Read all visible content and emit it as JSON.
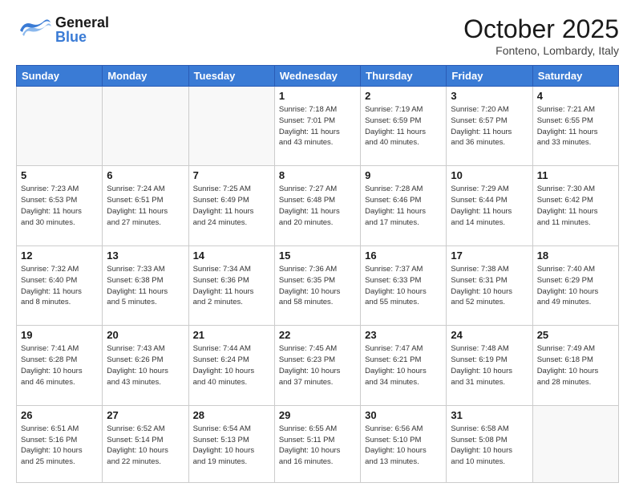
{
  "header": {
    "logo": {
      "general": "General",
      "blue": "Blue"
    },
    "title": "October 2025",
    "location": "Fonteno, Lombardy, Italy"
  },
  "days_of_week": [
    "Sunday",
    "Monday",
    "Tuesday",
    "Wednesday",
    "Thursday",
    "Friday",
    "Saturday"
  ],
  "weeks": [
    {
      "days": [
        {
          "num": "",
          "info": ""
        },
        {
          "num": "",
          "info": ""
        },
        {
          "num": "",
          "info": ""
        },
        {
          "num": "1",
          "info": "Sunrise: 7:18 AM\nSunset: 7:01 PM\nDaylight: 11 hours\nand 43 minutes."
        },
        {
          "num": "2",
          "info": "Sunrise: 7:19 AM\nSunset: 6:59 PM\nDaylight: 11 hours\nand 40 minutes."
        },
        {
          "num": "3",
          "info": "Sunrise: 7:20 AM\nSunset: 6:57 PM\nDaylight: 11 hours\nand 36 minutes."
        },
        {
          "num": "4",
          "info": "Sunrise: 7:21 AM\nSunset: 6:55 PM\nDaylight: 11 hours\nand 33 minutes."
        }
      ]
    },
    {
      "days": [
        {
          "num": "5",
          "info": "Sunrise: 7:23 AM\nSunset: 6:53 PM\nDaylight: 11 hours\nand 30 minutes."
        },
        {
          "num": "6",
          "info": "Sunrise: 7:24 AM\nSunset: 6:51 PM\nDaylight: 11 hours\nand 27 minutes."
        },
        {
          "num": "7",
          "info": "Sunrise: 7:25 AM\nSunset: 6:49 PM\nDaylight: 11 hours\nand 24 minutes."
        },
        {
          "num": "8",
          "info": "Sunrise: 7:27 AM\nSunset: 6:48 PM\nDaylight: 11 hours\nand 20 minutes."
        },
        {
          "num": "9",
          "info": "Sunrise: 7:28 AM\nSunset: 6:46 PM\nDaylight: 11 hours\nand 17 minutes."
        },
        {
          "num": "10",
          "info": "Sunrise: 7:29 AM\nSunset: 6:44 PM\nDaylight: 11 hours\nand 14 minutes."
        },
        {
          "num": "11",
          "info": "Sunrise: 7:30 AM\nSunset: 6:42 PM\nDaylight: 11 hours\nand 11 minutes."
        }
      ]
    },
    {
      "days": [
        {
          "num": "12",
          "info": "Sunrise: 7:32 AM\nSunset: 6:40 PM\nDaylight: 11 hours\nand 8 minutes."
        },
        {
          "num": "13",
          "info": "Sunrise: 7:33 AM\nSunset: 6:38 PM\nDaylight: 11 hours\nand 5 minutes."
        },
        {
          "num": "14",
          "info": "Sunrise: 7:34 AM\nSunset: 6:36 PM\nDaylight: 11 hours\nand 2 minutes."
        },
        {
          "num": "15",
          "info": "Sunrise: 7:36 AM\nSunset: 6:35 PM\nDaylight: 10 hours\nand 58 minutes."
        },
        {
          "num": "16",
          "info": "Sunrise: 7:37 AM\nSunset: 6:33 PM\nDaylight: 10 hours\nand 55 minutes."
        },
        {
          "num": "17",
          "info": "Sunrise: 7:38 AM\nSunset: 6:31 PM\nDaylight: 10 hours\nand 52 minutes."
        },
        {
          "num": "18",
          "info": "Sunrise: 7:40 AM\nSunset: 6:29 PM\nDaylight: 10 hours\nand 49 minutes."
        }
      ]
    },
    {
      "days": [
        {
          "num": "19",
          "info": "Sunrise: 7:41 AM\nSunset: 6:28 PM\nDaylight: 10 hours\nand 46 minutes."
        },
        {
          "num": "20",
          "info": "Sunrise: 7:43 AM\nSunset: 6:26 PM\nDaylight: 10 hours\nand 43 minutes."
        },
        {
          "num": "21",
          "info": "Sunrise: 7:44 AM\nSunset: 6:24 PM\nDaylight: 10 hours\nand 40 minutes."
        },
        {
          "num": "22",
          "info": "Sunrise: 7:45 AM\nSunset: 6:23 PM\nDaylight: 10 hours\nand 37 minutes."
        },
        {
          "num": "23",
          "info": "Sunrise: 7:47 AM\nSunset: 6:21 PM\nDaylight: 10 hours\nand 34 minutes."
        },
        {
          "num": "24",
          "info": "Sunrise: 7:48 AM\nSunset: 6:19 PM\nDaylight: 10 hours\nand 31 minutes."
        },
        {
          "num": "25",
          "info": "Sunrise: 7:49 AM\nSunset: 6:18 PM\nDaylight: 10 hours\nand 28 minutes."
        }
      ]
    },
    {
      "days": [
        {
          "num": "26",
          "info": "Sunrise: 6:51 AM\nSunset: 5:16 PM\nDaylight: 10 hours\nand 25 minutes."
        },
        {
          "num": "27",
          "info": "Sunrise: 6:52 AM\nSunset: 5:14 PM\nDaylight: 10 hours\nand 22 minutes."
        },
        {
          "num": "28",
          "info": "Sunrise: 6:54 AM\nSunset: 5:13 PM\nDaylight: 10 hours\nand 19 minutes."
        },
        {
          "num": "29",
          "info": "Sunrise: 6:55 AM\nSunset: 5:11 PM\nDaylight: 10 hours\nand 16 minutes."
        },
        {
          "num": "30",
          "info": "Sunrise: 6:56 AM\nSunset: 5:10 PM\nDaylight: 10 hours\nand 13 minutes."
        },
        {
          "num": "31",
          "info": "Sunrise: 6:58 AM\nSunset: 5:08 PM\nDaylight: 10 hours\nand 10 minutes."
        },
        {
          "num": "",
          "info": ""
        }
      ]
    }
  ]
}
